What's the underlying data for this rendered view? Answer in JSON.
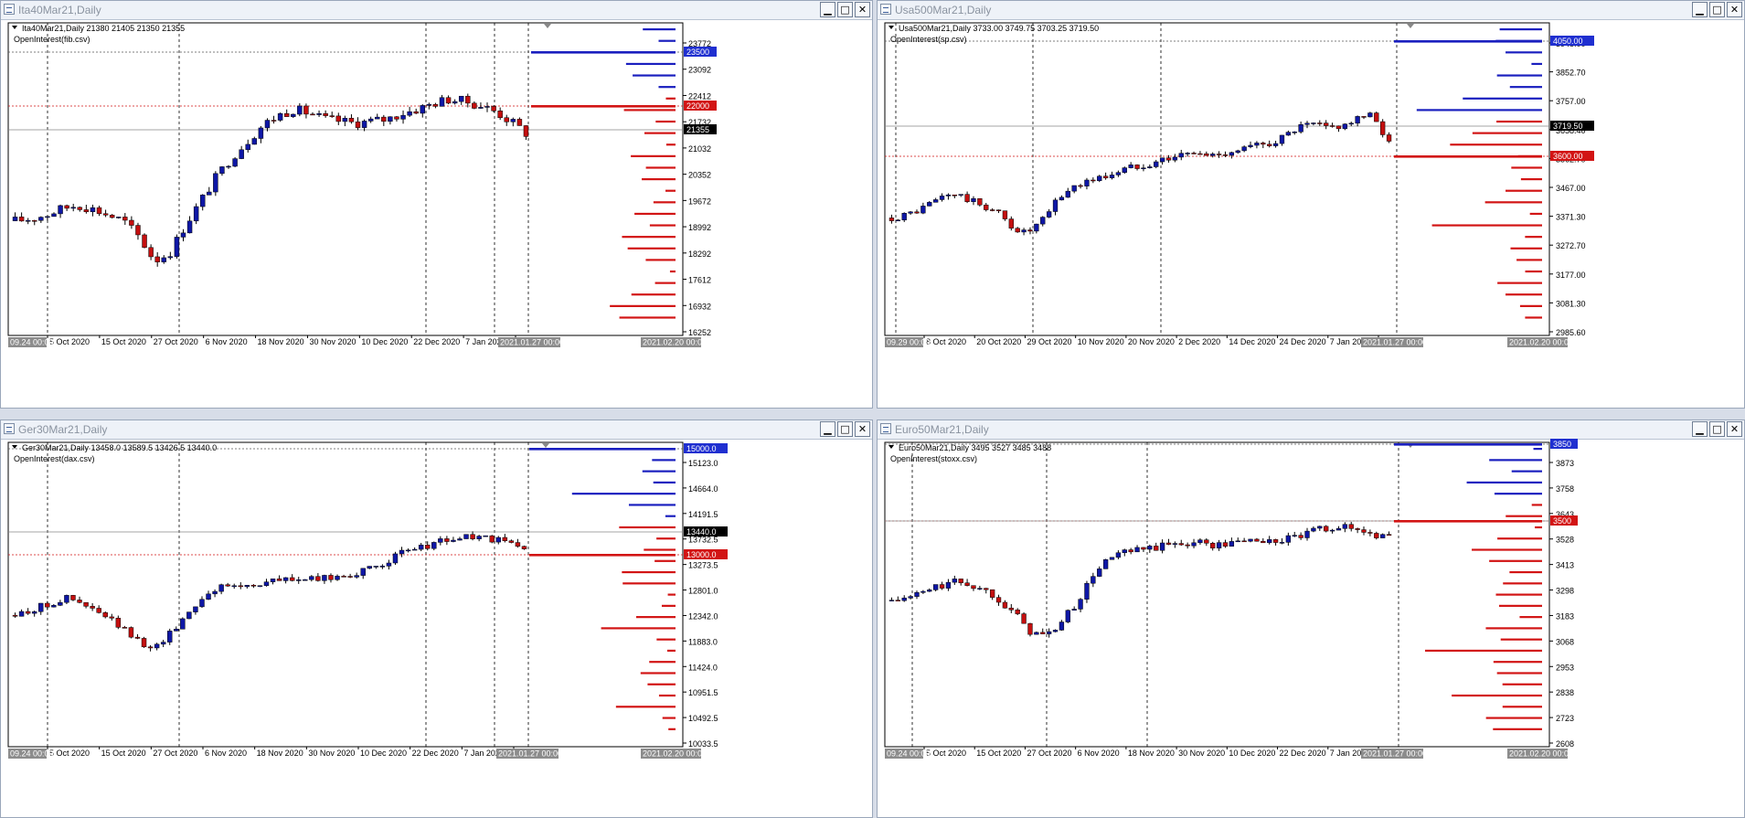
{
  "colors": {
    "bull": "#0e17a6",
    "bear": "#c40f0f",
    "oi_call": "#1a1fbf",
    "oi_put": "#d21414",
    "grid": "#000000",
    "box_blue": "#1f2fd0",
    "box_red": "#d21414",
    "box_black": "#000000",
    "time_box": "#8c8c8c"
  },
  "window_buttons": {
    "minimize": "▁",
    "maximize": "□",
    "close": "✕"
  },
  "icons": {
    "window": "chart-window-icon",
    "dropdown": "triangle-down-icon"
  },
  "windows": [
    {
      "title": "Ita40Mar21,Daily",
      "info": "Ita40Mar21,Daily  21380 21405 21350 21355",
      "indicator": "OpenInterest(fib.csv)",
      "price_labels": [
        "23772",
        "23092",
        "22412",
        "21732",
        "21032",
        "20352",
        "19672",
        "18992",
        "18292",
        "17612",
        "16932",
        "16252"
      ],
      "date_labels": [
        "5 Oct 2020",
        "15 Oct 2020",
        "27 Oct 2020",
        "6 Nov 2020",
        "18 Nov 2020",
        "30 Nov 2020",
        "10 Dec 2020",
        "22 Dec 2020",
        "7 Jan 2021",
        "19"
      ],
      "time_box_left": "09.24 00:00",
      "time_box_cursor": "2021.01.27 00:00",
      "time_box_right": "2021.02.20 00:00",
      "boxes": [
        {
          "text": "23500",
          "kind": "blue"
        },
        {
          "text": "22000",
          "kind": "red"
        },
        {
          "text": "21355",
          "kind": "black"
        }
      ]
    },
    {
      "title": "Usa500Mar21,Daily",
      "info": "Usa500Mar21,Daily  3733.00 3749.75 3703.25 3719.50",
      "indicator": "OpenInterest(sp.csv)",
      "price_labels": [
        "3948.00",
        "3852.70",
        "3757.00",
        "3658.40",
        "3562.70",
        "3467.00",
        "3371.30",
        "3272.70",
        "3177.00",
        "3081.30",
        "2985.60"
      ],
      "date_labels": [
        "8 Oct 2020",
        "20 Oct 2020",
        "29 Oct 2020",
        "10 Nov 2020",
        "20 Nov 2020",
        "2 Dec 2020",
        "14 Dec 2020",
        "24 Dec 2020",
        "7 Jan 2021",
        "19"
      ],
      "time_box_left": "09.29 00:00",
      "time_box_cursor": "2021.01.27 00:00",
      "time_box_right": "2021.02.20 00:00",
      "boxes": [
        {
          "text": "4050.00",
          "kind": "blue"
        },
        {
          "text": "3719.50",
          "kind": "black"
        },
        {
          "text": "3600.00",
          "kind": "red"
        }
      ]
    },
    {
      "title": "Ger30Mar21,Daily",
      "info": "Ger30Mar21,Daily  13458.0 13589.5 13426.5 13440.0",
      "indicator": "OpenInterest(dax.csv)",
      "price_labels": [
        "15123.0",
        "14664.0",
        "14191.5",
        "13732.5",
        "13273.5",
        "12801.0",
        "12342.0",
        "11883.0",
        "11424.0",
        "10951.5",
        "10492.5",
        "10033.5"
      ],
      "date_labels": [
        "5 Oct 2020",
        "15 Oct 2020",
        "27 Oct 2020",
        "6 Nov 2020",
        "18 Nov 2020",
        "30 Nov 2020",
        "10 Dec 2020",
        "22 Dec 2020",
        "7 Jan 2021",
        "19"
      ],
      "time_box_left": "09.24 00:00",
      "time_box_cursor": "2021.01.27 00:00",
      "time_box_right": "2021.02.20 00:00",
      "boxes": [
        {
          "text": "15000.0",
          "kind": "blue"
        },
        {
          "text": "13440.0",
          "kind": "black"
        },
        {
          "text": "13000.0",
          "kind": "red"
        }
      ]
    },
    {
      "title": "Euro50Mar21,Daily",
      "info": "Euro50Mar21,Daily  3495 3527 3485 3488",
      "indicator": "OpenInterest(stoxx.csv)",
      "price_labels": [
        "3873",
        "3758",
        "3643",
        "3528",
        "3413",
        "3298",
        "3183",
        "3068",
        "2953",
        "2838",
        "2723",
        "2608"
      ],
      "date_labels": [
        "5 Oct 2020",
        "15 Oct 2020",
        "27 Oct 2020",
        "6 Nov 2020",
        "18 Nov 2020",
        "30 Nov 2020",
        "10 Dec 2020",
        "22 Dec 2020",
        "7 Jan 2021",
        "19"
      ],
      "time_box_left": "09.24 00:00",
      "time_box_cursor": "2021.01.27 00:00",
      "time_box_right": "2021.02.20 00:00",
      "boxes": [
        {
          "text": "3850",
          "kind": "blue"
        },
        {
          "text": "3500",
          "kind": "red"
        }
      ]
    }
  ]
}
